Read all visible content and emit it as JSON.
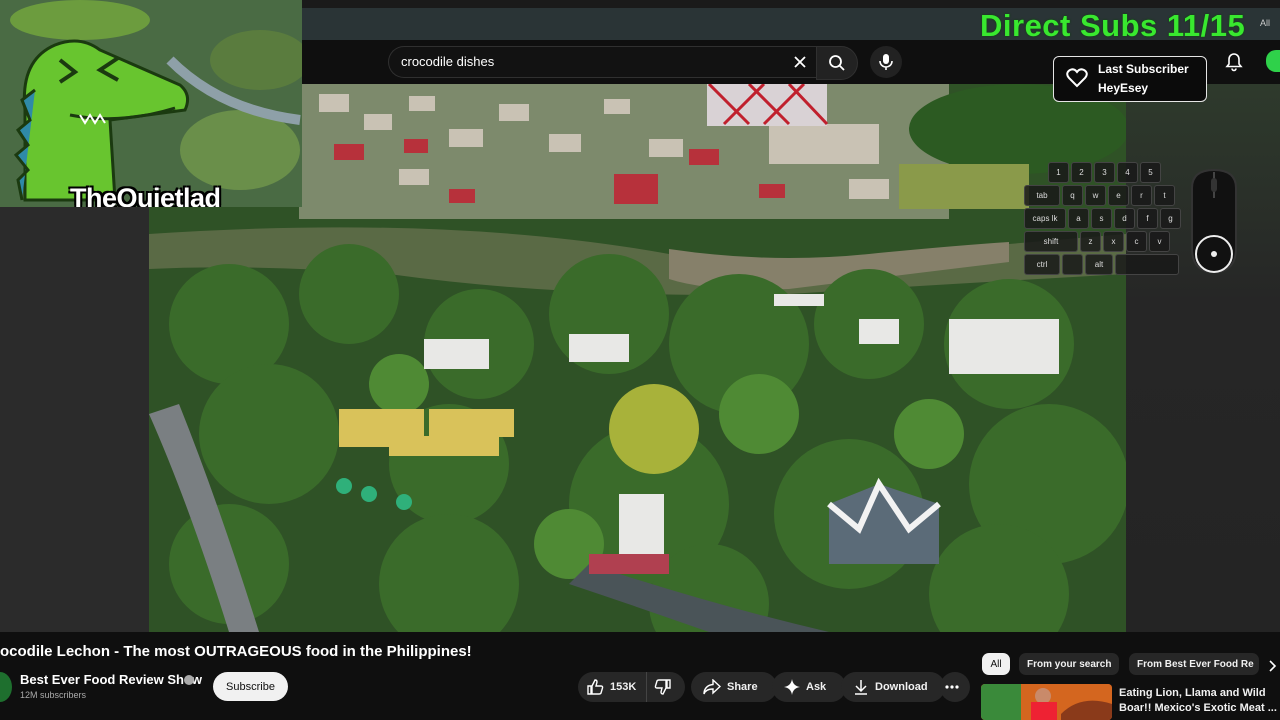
{
  "overlay": {
    "direct_subs": "Direct Subs 11/15",
    "all_label": "All",
    "last_sub_label": "Last Subscriber",
    "last_sub_name": "HeyEsey",
    "cam_name": "TheQuietlad"
  },
  "search": {
    "query": "crocodile dishes"
  },
  "keyboard": {
    "rows": [
      [
        "1",
        "2",
        "3",
        "4",
        "5"
      ],
      [
        "tab",
        "q",
        "w",
        "e",
        "r",
        "t"
      ],
      [
        "caps lk",
        "a",
        "s",
        "d",
        "f",
        "g"
      ],
      [
        "shift",
        "z",
        "x",
        "c",
        "v"
      ],
      [
        "ctrl",
        "",
        "alt",
        ""
      ]
    ]
  },
  "video": {
    "title": "ocodile Lechon - The most OUTRAGEOUS food in the Philippines!",
    "channel": "Best Ever Food Review Show",
    "subscribers": "12M subscribers",
    "subscribe_label": "Subscribe",
    "likes": "153K",
    "share_label": "Share",
    "ask_label": "Ask",
    "download_label": "Download"
  },
  "chips": {
    "all": "All",
    "from_search": "From your search",
    "from_channel": "From Best Ever Food Re"
  },
  "related": {
    "title": "Eating Lion, Llama and Wild Boar!! Mexico's Exotic Meat ..."
  },
  "colors": {
    "accent_green": "#39e82f",
    "background": "#0f0f0f"
  }
}
